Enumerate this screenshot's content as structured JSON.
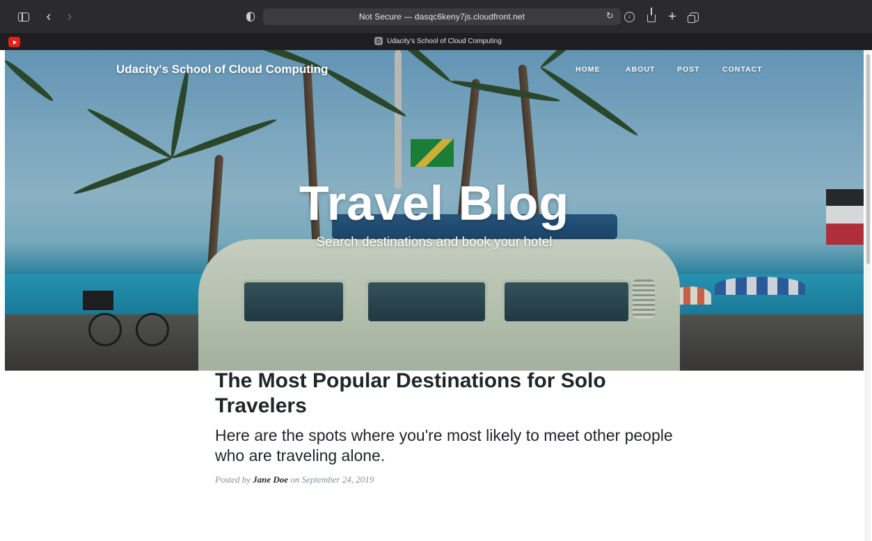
{
  "browser": {
    "url": "Not Secure — dasqc6keny7js.cloudfront.net",
    "tab_title": "Udacity's School of Cloud Computing",
    "tab_favicon": "D",
    "icons": [
      "sidebar-icon",
      "back-icon",
      "forward-icon",
      "shield-icon",
      "reload-icon",
      "download-icon",
      "share-icon",
      "new-tab-icon",
      "tabs-overview-icon",
      "youtube-icon"
    ]
  },
  "site": {
    "brand": "Udacity's School of Cloud Computing",
    "nav": {
      "home": "HOME",
      "about": "ABOUT",
      "post": "POST",
      "contact": "CONTACT"
    }
  },
  "hero": {
    "title": "Travel Blog",
    "subtitle": "Search destinations and book your hotel"
  },
  "post": {
    "title": "The Most Popular Destinations for Solo Travelers",
    "subtitle": "Here are the spots where you're most likely to meet other people who are traveling alone.",
    "meta_prefix": "Posted by",
    "author": "Jane Doe",
    "meta_on": "on",
    "date": "September 24, 2019"
  },
  "colors": {
    "chrome_bg": "#2b2b2e",
    "url_bg": "#3c3c3f",
    "heading_text": "#212529",
    "meta_text": "#868e96"
  }
}
